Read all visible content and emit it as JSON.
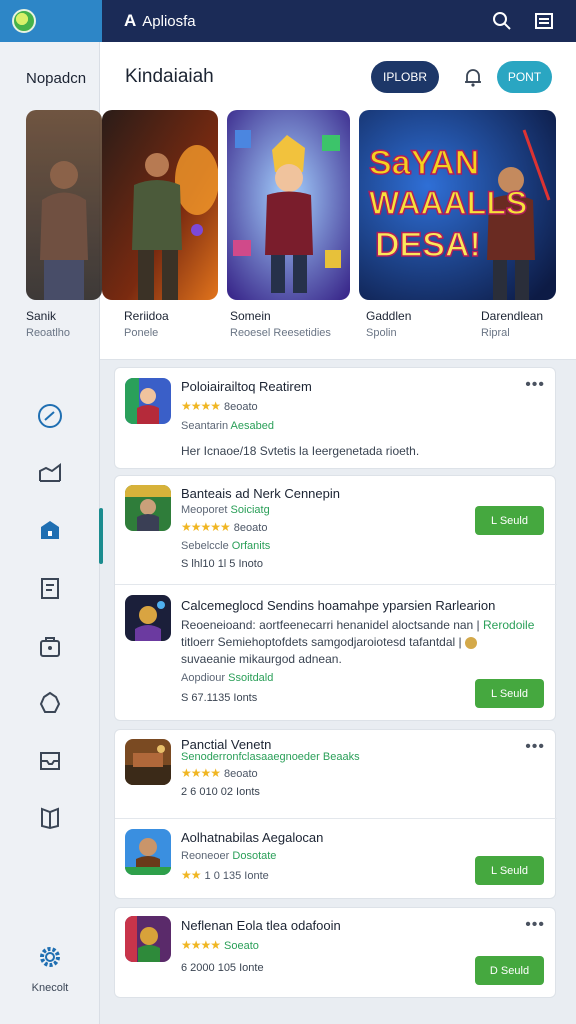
{
  "topbar": {
    "brand_mark": "A",
    "brand": "Apliosfa"
  },
  "sidebar": {
    "title": "Nopadcn",
    "items": [
      {
        "icon": "gauge-icon"
      },
      {
        "icon": "chart-icon"
      },
      {
        "icon": "home-icon",
        "active": true
      },
      {
        "icon": "clipboard-icon"
      },
      {
        "icon": "bag-icon"
      },
      {
        "icon": "puzzle-icon"
      },
      {
        "icon": "inbox-icon"
      },
      {
        "icon": "book-icon"
      }
    ],
    "settings_label": "Knecolt"
  },
  "featured": {
    "title": "Kindaiaiah",
    "btn_primary": "IPLOBR",
    "btn_secondary": "PONT",
    "cards": [
      {
        "label": "Sanik",
        "sub": "Reoatlho"
      },
      {
        "label": "Reriidoa",
        "sub": "Ponele"
      },
      {
        "label": "Somein",
        "sub": "Reoesel Reesetidies"
      },
      {
        "label": "Gaddlen",
        "sub": "Spolin"
      },
      {
        "label": "Darendlean",
        "sub": "Ripral"
      }
    ],
    "banner_text": [
      "SaYAN",
      "WAAALLS",
      "DESA!"
    ]
  },
  "list1": {
    "app": {
      "name": "Poloiairailtoq Reatirem",
      "rating_text": "8eoato",
      "tag_prefix": "Seantarin",
      "tag_green": "Aesabed",
      "desc": "Her Icnaoe/18 Svtetis la Ieergenetada rioeth."
    }
  },
  "list2": {
    "apps": [
      {
        "name": "Banteais ad Nerk Cennepin",
        "tag_prefix": "Meoporet",
        "tag_green": "Soiciatg",
        "rating_text": "8eoato",
        "sub_prefix": "Sebelccle",
        "sub_green": "Orfanits",
        "size": "S lhl10 1l 5 Inoto",
        "button": "L Seuld"
      },
      {
        "name": "Calcemeglocd Sendins hoamahpe yparsien Rarlearion",
        "desc1": "Reoeneioand: aortfeenecarri henanidel aloctsande nan |",
        "desc1_green": "Rerodoile",
        "desc2": "titloerr Semiehoptofdets samgodjaroiotesd tafantdal |",
        "desc3": "suvaeanie mikaurgod adnean.",
        "tag_prefix": "Aopdiour",
        "tag_green": "Ssoitdald",
        "size": "S 67.1135 Ionts",
        "button": "L Seuld"
      }
    ]
  },
  "list3": {
    "apps": [
      {
        "name": "Panctial Venetn",
        "tag_green": "Senoderronfclasaaegnoeder Beaaks",
        "rating_text": "8eoato",
        "size": "2 6 010 02 Ionts",
        "has_menu": true
      },
      {
        "name": "Aolhatnabilas Aegalocan",
        "tag_prefix": "Reoneoer",
        "tag_green": "Dosotate",
        "size": "1 0 135 Ionte",
        "button": "L Seuld"
      }
    ]
  },
  "list4": {
    "app": {
      "name": "Neflenan Eola tlea odafooin",
      "rating_text": "Soeato",
      "size": "6 2000 105 Ionte",
      "button": "D Seuld"
    }
  },
  "colors": {
    "topbar": "#1b2b57",
    "accent_teal": "#2aa6c2",
    "get_green": "#45a83f",
    "star": "#f0b623",
    "tag_green": "#2a9f58"
  }
}
